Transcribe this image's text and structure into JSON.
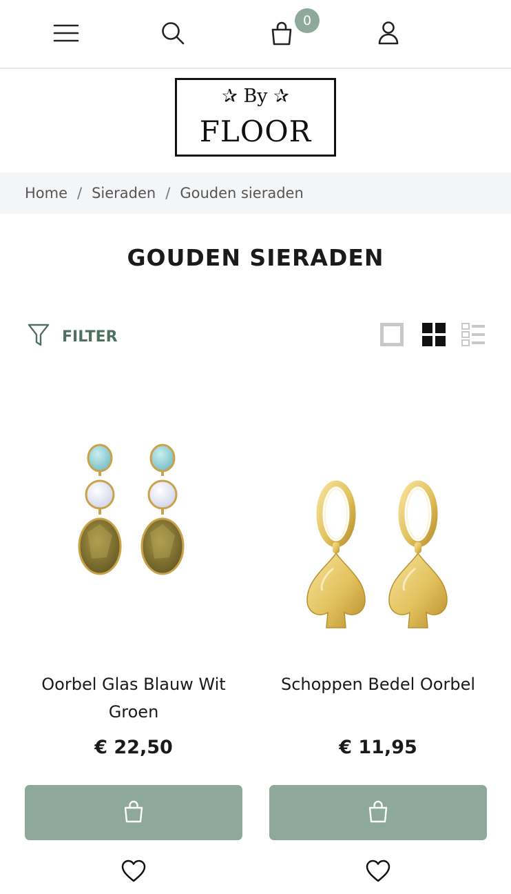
{
  "header": {
    "menu_icon": "hamburger-menu-icon",
    "search_icon": "search-icon",
    "cart_icon": "shopping-bag-icon",
    "cart_count": "0",
    "account_icon": "user-icon"
  },
  "logo": {
    "top": "✰ By ✰",
    "name": "FLOOR"
  },
  "breadcrumb": {
    "items": [
      "Home",
      "Sieraden",
      "Gouden sieraden"
    ],
    "separator": "/"
  },
  "page": {
    "title": "GOUDEN SIERADEN"
  },
  "toolbar": {
    "filter_label": "FILTER",
    "view_options": [
      "single-column-view-icon",
      "grid-view-icon",
      "list-view-icon"
    ],
    "active_view": "grid-view-icon"
  },
  "products": [
    {
      "name": "Oorbel Glas Blauw Wit Groen",
      "price": "€ 22,50",
      "image": "earrings-blue-white-green-glass"
    },
    {
      "name": "Schoppen Bedel Oorbel",
      "price": "€ 11,95",
      "image": "gold-spade-charm-earrings"
    }
  ],
  "colors": {
    "accent": "#8fa89c",
    "filter_text": "#4f7060",
    "breadcrumb_bg": "#f4f5f7"
  }
}
